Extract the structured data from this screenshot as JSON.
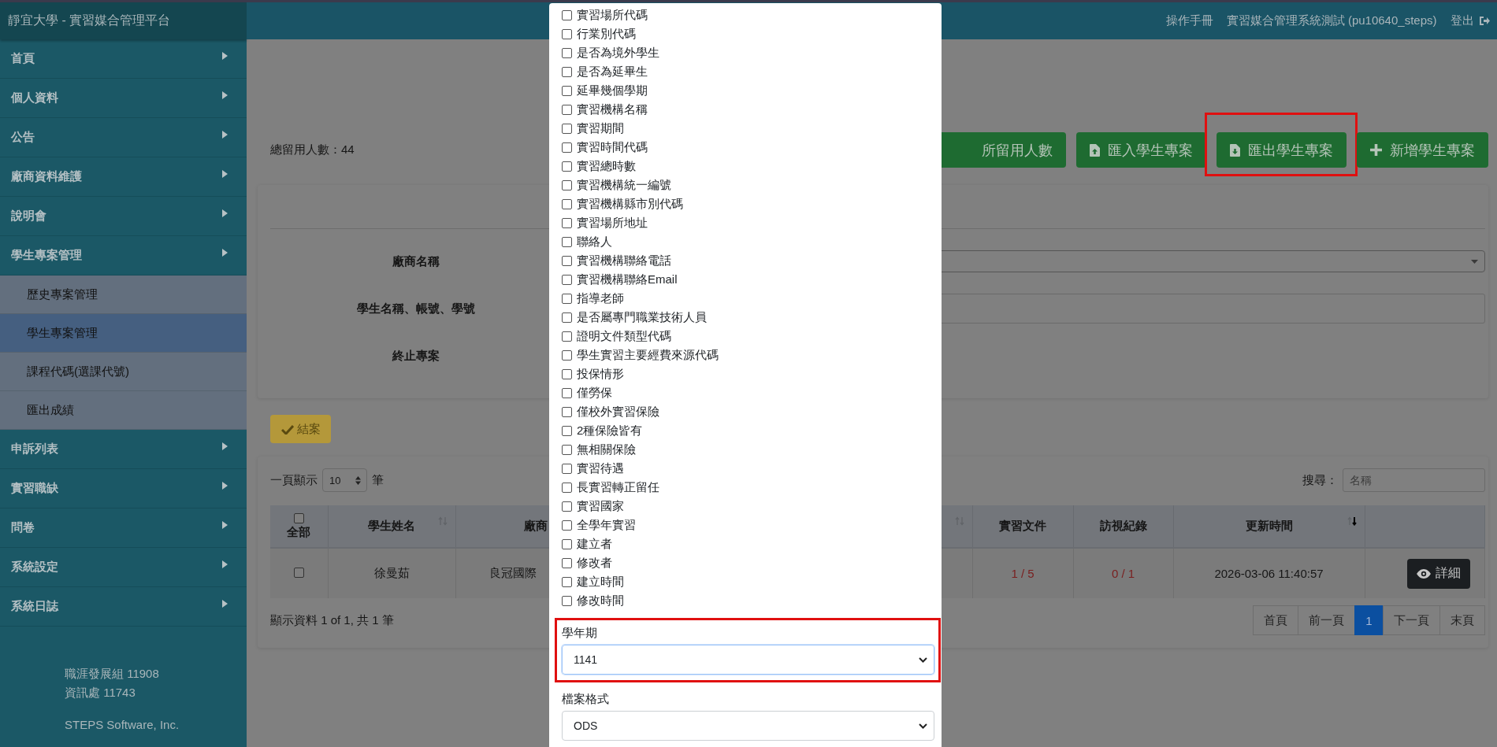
{
  "header": {
    "brand": "靜宜大學 - 實習媒合管理平台",
    "links": [
      {
        "label": "操作手冊",
        "kind": "text"
      },
      {
        "label": "實習媒合管理系統測試 (pu10640_steps)",
        "kind": "text"
      },
      {
        "label": "登出",
        "kind": "logout"
      }
    ]
  },
  "sidebar": {
    "items": [
      {
        "label": "首頁"
      },
      {
        "label": "個人資料"
      },
      {
        "label": "公告"
      },
      {
        "label": "廠商資料維護"
      },
      {
        "label": "說明會"
      },
      {
        "label": "學生專案管理",
        "children": [
          {
            "label": "歷史專案管理",
            "selected": false
          },
          {
            "label": "學生專案管理",
            "selected": true
          },
          {
            "label": "課程代碼(選課代號)",
            "selected": false
          },
          {
            "label": "匯出成績",
            "selected": false
          }
        ]
      },
      {
        "label": "申訴列表"
      },
      {
        "label": "實習職缺"
      },
      {
        "label": "問卷"
      },
      {
        "label": "系統設定"
      },
      {
        "label": "系統日誌"
      }
    ],
    "footer": [
      "職涯發展組 11908",
      "資訊處 11743",
      "STEPS Software, Inc."
    ]
  },
  "toolbar": {
    "total": "總留用人數：44",
    "buttons": [
      {
        "label": "所留用人數",
        "kind": "plain",
        "highlighted": false
      },
      {
        "label": "匯入學生專案",
        "kind": "import",
        "highlighted": false
      },
      {
        "label": "匯出學生專案",
        "kind": "export",
        "highlighted": true
      },
      {
        "label": "新增學生專案",
        "kind": "add",
        "highlighted": false
      }
    ]
  },
  "filters": [
    {
      "label": "廠商名稱",
      "kind": "select"
    },
    {
      "label": "學生名稱、帳號、學號",
      "kind": "text"
    },
    {
      "label": "終止專案"
    }
  ],
  "close_case": {
    "label": "結案"
  },
  "table": {
    "page_size_before": "一頁顯示",
    "page_size": "10",
    "page_size_after": "筆",
    "search_label": "搜尋：",
    "search_placeholder": "名稱",
    "columns": [
      {
        "label": "全部",
        "kind": "check",
        "checked": false
      },
      {
        "label": "學生姓名",
        "kind": "sortable",
        "sorted": false
      },
      {
        "label": "廠商",
        "kind": "text"
      },
      {
        "kind": "sortable",
        "sorted": false
      },
      {
        "label": "實習文件",
        "kind": "text"
      },
      {
        "label": "訪視紀錄",
        "kind": "text"
      },
      {
        "label": "更新時間",
        "kind": "sortable",
        "sorted": true
      },
      {
        "kind": "action"
      }
    ],
    "rows": [
      {
        "checked": false,
        "student": "徐曼茹",
        "company": "良冠國際",
        "documents": "1 / 5",
        "visits": "0 / 1",
        "updated": "2026-03-06 11:40:57",
        "action": "詳細"
      }
    ],
    "summary": "顯示資料 1 of 1, 共 1 筆",
    "pagination": [
      {
        "label": "首頁",
        "selected": false
      },
      {
        "label": "前一頁",
        "selected": false
      },
      {
        "label": "1",
        "selected": true
      },
      {
        "label": "下一頁",
        "selected": false
      },
      {
        "label": "末頁",
        "selected": false
      }
    ]
  },
  "modal": {
    "fields": [
      {
        "label": "實習場所代碼",
        "checked": false
      },
      {
        "label": "行業別代碼",
        "checked": false
      },
      {
        "label": "是否為境外學生",
        "checked": false
      },
      {
        "label": "是否為延畢生",
        "checked": false
      },
      {
        "label": "延畢幾個學期",
        "checked": false
      },
      {
        "label": "實習機構名稱",
        "checked": false
      },
      {
        "label": "實習期間",
        "checked": false
      },
      {
        "label": "實習時間代碼",
        "checked": false
      },
      {
        "label": "實習總時數",
        "checked": false
      },
      {
        "label": "實習機構統一編號",
        "checked": false
      },
      {
        "label": "實習機構縣市別代碼",
        "checked": false
      },
      {
        "label": "實習場所地址",
        "checked": false
      },
      {
        "label": "聯絡人",
        "checked": false
      },
      {
        "label": "實習機構聯絡電話",
        "checked": false
      },
      {
        "label": "實習機構聯絡Email",
        "checked": false
      },
      {
        "label": "指導老師",
        "checked": false
      },
      {
        "label": "是否屬專門職業技術人員",
        "checked": false
      },
      {
        "label": "證明文件類型代碼",
        "checked": false
      },
      {
        "label": "學生實習主要經費來源代碼",
        "checked": false
      },
      {
        "label": "投保情形",
        "checked": false
      },
      {
        "label": "僅勞保",
        "checked": false
      },
      {
        "label": "僅校外實習保險",
        "checked": false
      },
      {
        "label": "2種保險皆有",
        "checked": false
      },
      {
        "label": "無相關保險",
        "checked": false
      },
      {
        "label": "實習待遇",
        "checked": false
      },
      {
        "label": "長實習轉正留任",
        "checked": false
      },
      {
        "label": "實習國家",
        "checked": false
      },
      {
        "label": "全學年實習",
        "checked": false
      },
      {
        "label": "建立者",
        "checked": false
      },
      {
        "label": "修改者",
        "checked": false
      },
      {
        "label": "建立時間",
        "checked": false
      },
      {
        "label": "修改時間",
        "checked": false
      }
    ],
    "term": {
      "label": "學年期",
      "value": "1141",
      "highlighted": true
    },
    "format": {
      "label": "檔案格式",
      "value": "ODS",
      "highlighted": false
    }
  }
}
